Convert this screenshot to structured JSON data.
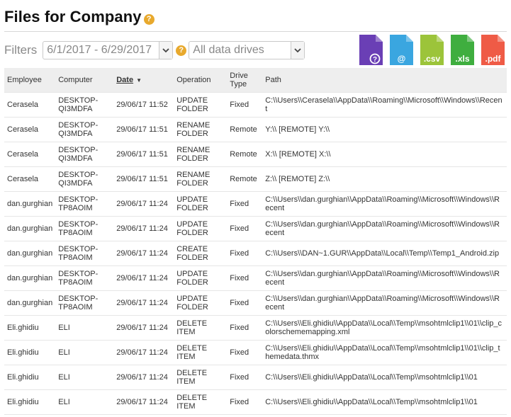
{
  "title": "Files for Company",
  "help_glyph": "?",
  "filters": {
    "label": "Filters",
    "date_range": "6/1/2017 - 6/29/2017",
    "drive": "All data drives"
  },
  "exports": [
    {
      "name": "help-export",
      "ext": "",
      "color": "#6a3fb5",
      "icon": "question-icon"
    },
    {
      "name": "email-export",
      "ext": "@",
      "color": "#3aa6e0",
      "icon": "email-icon"
    },
    {
      "name": "csv-export",
      "ext": ".csv",
      "color": "#9cc43a",
      "icon": "csv-file-icon"
    },
    {
      "name": "xls-export",
      "ext": ".xls",
      "color": "#3fae3f",
      "icon": "xls-file-icon"
    },
    {
      "name": "pdf-export",
      "ext": ".pdf",
      "color": "#ef5b46",
      "icon": "pdf-file-icon"
    }
  ],
  "table": {
    "headers": {
      "employee": "Employee",
      "computer": "Computer",
      "date": "Date",
      "operation": "Operation",
      "drive_type": "Drive Type",
      "path": "Path"
    },
    "rows": [
      {
        "employee": "Cerasela",
        "computer": "DESKTOP-QI3MDFA",
        "date": "29/06/17 11:52",
        "operation": "UPDATE FOLDER",
        "drive": "Fixed",
        "path": "C:\\\\Users\\\\Cerasela\\\\AppData\\\\Roaming\\\\Microsoft\\\\Windows\\\\Recent"
      },
      {
        "employee": "Cerasela",
        "computer": "DESKTOP-QI3MDFA",
        "date": "29/06/17 11:51",
        "operation": "RENAME FOLDER",
        "drive": "Remote",
        "path": "Y:\\\\ [REMOTE] Y:\\\\"
      },
      {
        "employee": "Cerasela",
        "computer": "DESKTOP-QI3MDFA",
        "date": "29/06/17 11:51",
        "operation": "RENAME FOLDER",
        "drive": "Remote",
        "path": "X:\\\\ [REMOTE] X:\\\\"
      },
      {
        "employee": "Cerasela",
        "computer": "DESKTOP-QI3MDFA",
        "date": "29/06/17 11:51",
        "operation": "RENAME FOLDER",
        "drive": "Remote",
        "path": "Z:\\\\ [REMOTE] Z:\\\\"
      },
      {
        "employee": "dan.gurghian",
        "computer": "DESKTOP-TP8AOIM",
        "date": "29/06/17 11:24",
        "operation": "UPDATE FOLDER",
        "drive": "Fixed",
        "path": "C:\\\\Users\\\\dan.gurghian\\\\AppData\\\\Roaming\\\\Microsoft\\\\Windows\\\\Recent"
      },
      {
        "employee": "dan.gurghian",
        "computer": "DESKTOP-TP8AOIM",
        "date": "29/06/17 11:24",
        "operation": "UPDATE FOLDER",
        "drive": "Fixed",
        "path": "C:\\\\Users\\\\dan.gurghian\\\\AppData\\\\Roaming\\\\Microsoft\\\\Windows\\\\Recent"
      },
      {
        "employee": "dan.gurghian",
        "computer": "DESKTOP-TP8AOIM",
        "date": "29/06/17 11:24",
        "operation": "CREATE FOLDER",
        "drive": "Fixed",
        "path": "C:\\\\Users\\\\DAN~1.GUR\\\\AppData\\\\Local\\\\Temp\\\\Temp1_Android.zip"
      },
      {
        "employee": "dan.gurghian",
        "computer": "DESKTOP-TP8AOIM",
        "date": "29/06/17 11:24",
        "operation": "UPDATE FOLDER",
        "drive": "Fixed",
        "path": "C:\\\\Users\\\\dan.gurghian\\\\AppData\\\\Roaming\\\\Microsoft\\\\Windows\\\\Recent"
      },
      {
        "employee": "dan.gurghian",
        "computer": "DESKTOP-TP8AOIM",
        "date": "29/06/17 11:24",
        "operation": "UPDATE FOLDER",
        "drive": "Fixed",
        "path": "C:\\\\Users\\\\dan.gurghian\\\\AppData\\\\Roaming\\\\Microsoft\\\\Windows\\\\Recent"
      },
      {
        "employee": "Eli.ghidiu",
        "computer": "ELI",
        "date": "29/06/17 11:24",
        "operation": "DELETE ITEM",
        "drive": "Fixed",
        "path": "C:\\\\Users\\\\Eli.ghidiu\\\\AppData\\\\Local\\\\Temp\\\\msohtmlclip1\\\\01\\\\clip_colorschememapping.xml"
      },
      {
        "employee": "Eli.ghidiu",
        "computer": "ELI",
        "date": "29/06/17 11:24",
        "operation": "DELETE ITEM",
        "drive": "Fixed",
        "path": "C:\\\\Users\\\\Eli.ghidiu\\\\AppData\\\\Local\\\\Temp\\\\msohtmlclip1\\\\01\\\\clip_themedata.thmx"
      },
      {
        "employee": "Eli.ghidiu",
        "computer": "ELI",
        "date": "29/06/17 11:24",
        "operation": "DELETE ITEM",
        "drive": "Fixed",
        "path": "C:\\\\Users\\\\Eli.ghidiu\\\\AppData\\\\Local\\\\Temp\\\\msohtmlclip1\\\\01"
      },
      {
        "employee": "Eli.ghidiu",
        "computer": "ELI",
        "date": "29/06/17 11:24",
        "operation": "DELETE ITEM",
        "drive": "Fixed",
        "path": "C:\\\\Users\\\\Eli.ghidiu\\\\AppData\\\\Local\\\\Temp\\\\msohtmlclip1\\\\01"
      }
    ]
  }
}
